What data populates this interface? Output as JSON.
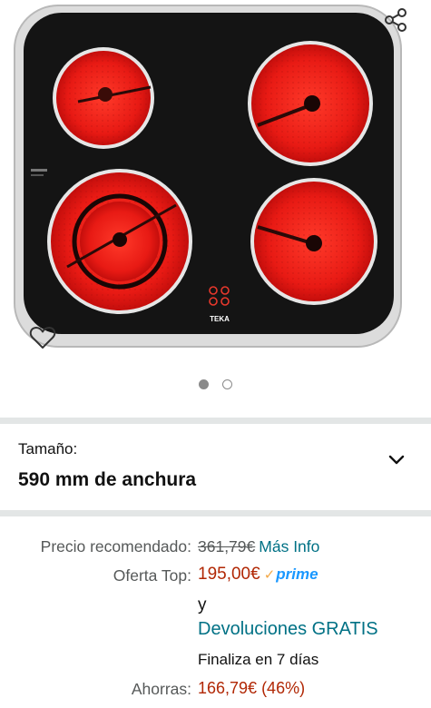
{
  "product": {
    "brand_logo_text": "TEKA",
    "image_alt": "Placa vitrocerámica TEKA de 4 zonas",
    "gallery_total": 2,
    "gallery_active": 1
  },
  "variation": {
    "label": "Tamaño:",
    "value": "590 mm de anchura"
  },
  "pricing": {
    "list_label": "Precio recomendado:",
    "list_price": "361,79€",
    "more_info": "Más Info",
    "deal_label": "Oferta Top:",
    "deal_price": "195,00€",
    "prime_label": "prime",
    "connector": "y",
    "returns": "Devoluciones GRATIS",
    "ends": "Finaliza en 7 días",
    "savings_label": "Ahorras:",
    "savings_value": "166,79€ (46%)"
  },
  "colors": {
    "price_red": "#b12704",
    "link_teal": "#007185",
    "prime_blue": "#1a98ff",
    "divider": "#e3e6e6"
  },
  "icons": {
    "share": "share-icon",
    "wishlist": "heart-icon",
    "expand": "chevron-down-icon",
    "prime_check": "check-icon"
  }
}
